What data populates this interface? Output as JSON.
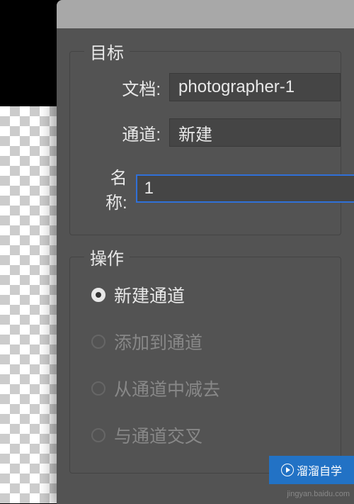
{
  "dialog": {
    "target": {
      "legend": "目标",
      "document": {
        "label": "文档:",
        "value": "photographer-1"
      },
      "channel": {
        "label": "通道:",
        "value": "新建"
      },
      "name": {
        "label": "名称:",
        "value": "1"
      }
    },
    "operation": {
      "legend": "操作",
      "options": [
        {
          "label": "新建通道",
          "selected": true,
          "enabled": true
        },
        {
          "label": "添加到通道",
          "selected": false,
          "enabled": false
        },
        {
          "label": "从通道中减去",
          "selected": false,
          "enabled": false
        },
        {
          "label": "与通道交叉",
          "selected": false,
          "enabled": false
        }
      ]
    }
  },
  "overlay": {
    "brand": "溜溜自学",
    "watermark": "jingyan.baidu.com"
  }
}
